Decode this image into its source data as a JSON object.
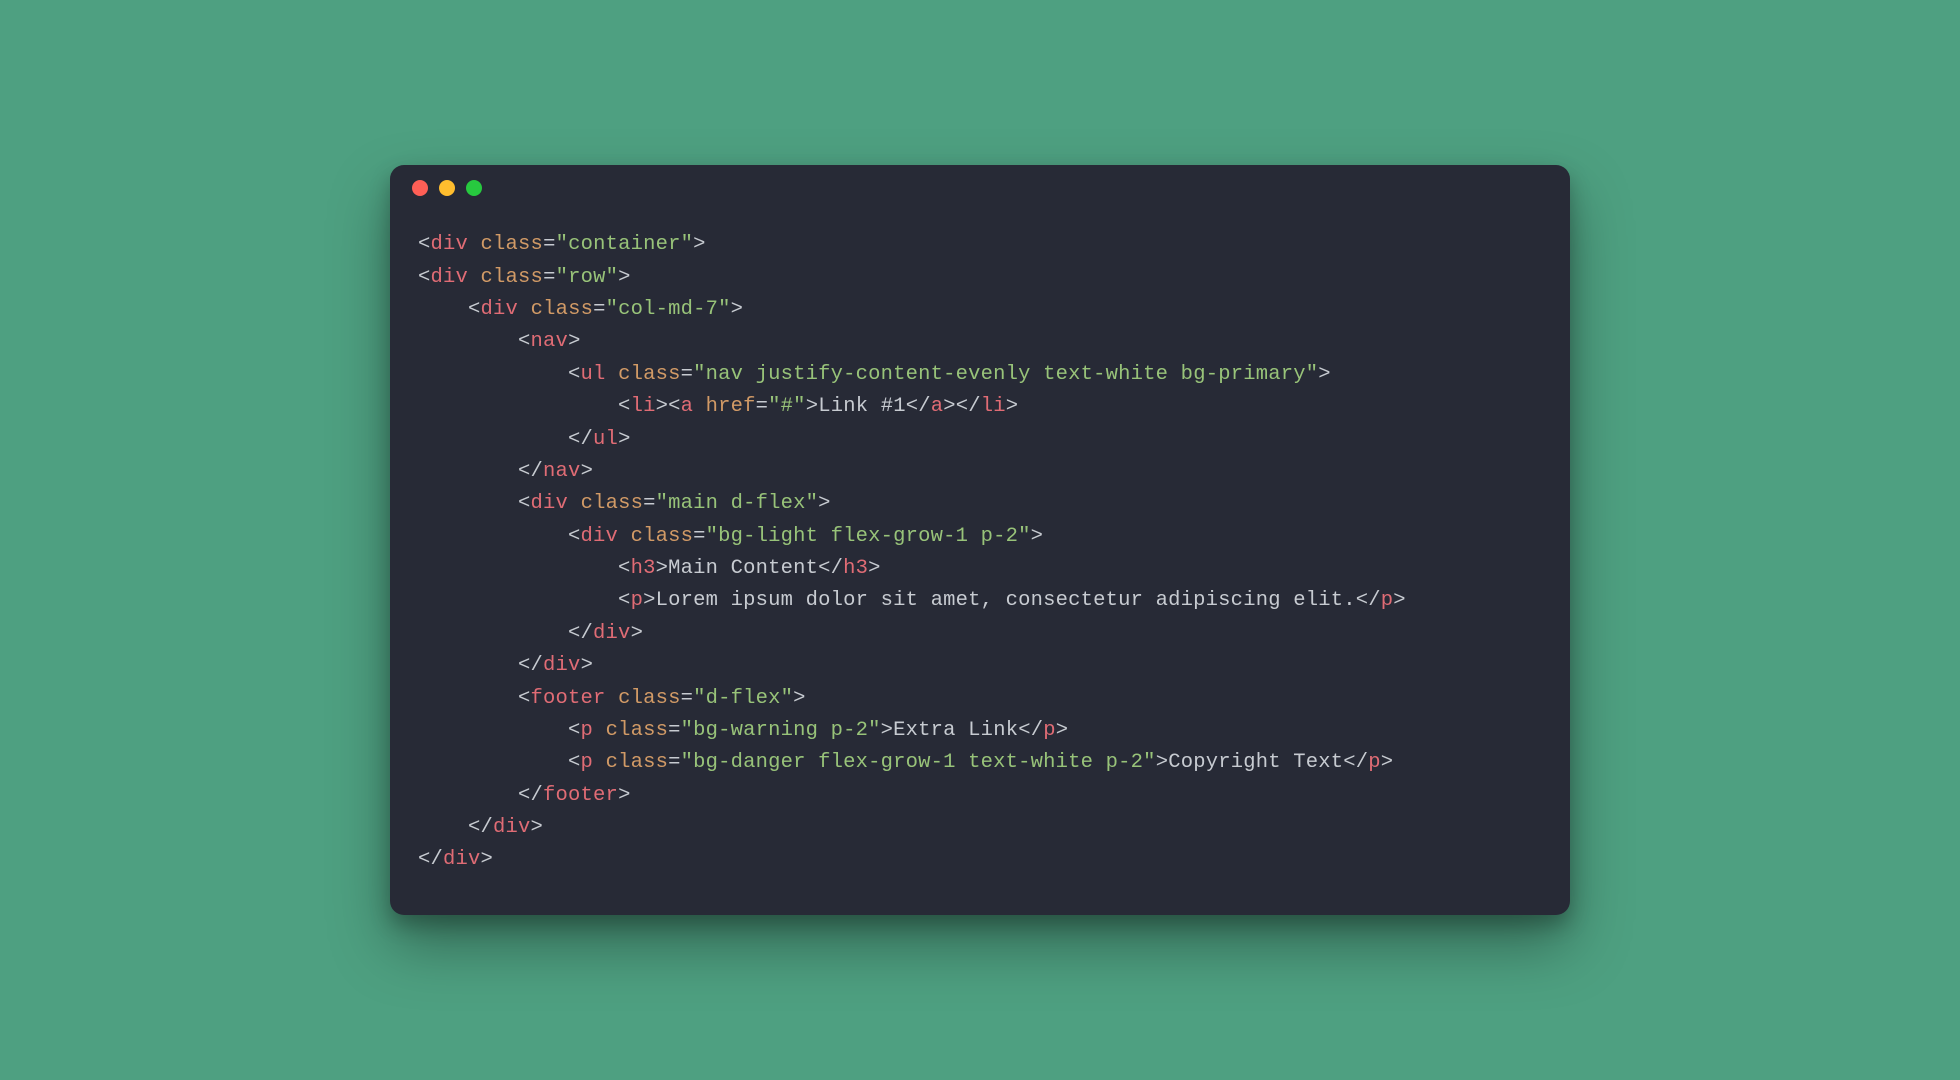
{
  "code": {
    "lines": [
      {
        "indent": 0,
        "type": "open",
        "tag": "div",
        "attrs": [
          [
            "class",
            "container"
          ]
        ]
      },
      {
        "indent": 0,
        "type": "open",
        "tag": "div",
        "attrs": [
          [
            "class",
            "row"
          ]
        ]
      },
      {
        "indent": 1,
        "type": "open",
        "tag": "div",
        "attrs": [
          [
            "class",
            "col-md-7"
          ]
        ]
      },
      {
        "indent": 2,
        "type": "open",
        "tag": "nav"
      },
      {
        "indent": 3,
        "type": "open",
        "tag": "ul",
        "attrs": [
          [
            "class",
            "nav justify-content-evenly text-white bg-primary"
          ]
        ]
      },
      {
        "indent": 4,
        "type": "li_link",
        "href": "#",
        "text": "Link #1"
      },
      {
        "indent": 3,
        "type": "close",
        "tag": "ul"
      },
      {
        "indent": 2,
        "type": "close",
        "tag": "nav"
      },
      {
        "indent": 2,
        "type": "open",
        "tag": "div",
        "attrs": [
          [
            "class",
            "main d-flex"
          ]
        ]
      },
      {
        "indent": 3,
        "type": "open",
        "tag": "div",
        "attrs": [
          [
            "class",
            "bg-light flex-grow-1 p-2"
          ]
        ]
      },
      {
        "indent": 4,
        "type": "wrap",
        "tag": "h3",
        "text": "Main Content"
      },
      {
        "indent": 4,
        "type": "wrap",
        "tag": "p",
        "text": "Lorem ipsum dolor sit amet, consectetur adipiscing elit."
      },
      {
        "indent": 3,
        "type": "close",
        "tag": "div"
      },
      {
        "indent": 2,
        "type": "close",
        "tag": "div"
      },
      {
        "indent": 2,
        "type": "open",
        "tag": "footer",
        "attrs": [
          [
            "class",
            "d-flex"
          ]
        ]
      },
      {
        "indent": 3,
        "type": "wrap",
        "tag": "p",
        "attrs": [
          [
            "class",
            "bg-warning p-2"
          ]
        ],
        "text": "Extra Link"
      },
      {
        "indent": 3,
        "type": "wrap",
        "tag": "p",
        "attrs": [
          [
            "class",
            "bg-danger flex-grow-1 text-white p-2"
          ]
        ],
        "text": "Copyright Text"
      },
      {
        "indent": 2,
        "type": "close",
        "tag": "footer"
      },
      {
        "indent": 1,
        "type": "close",
        "tag": "div"
      },
      {
        "indent": 0,
        "type": "close",
        "tag": "div"
      }
    ]
  }
}
